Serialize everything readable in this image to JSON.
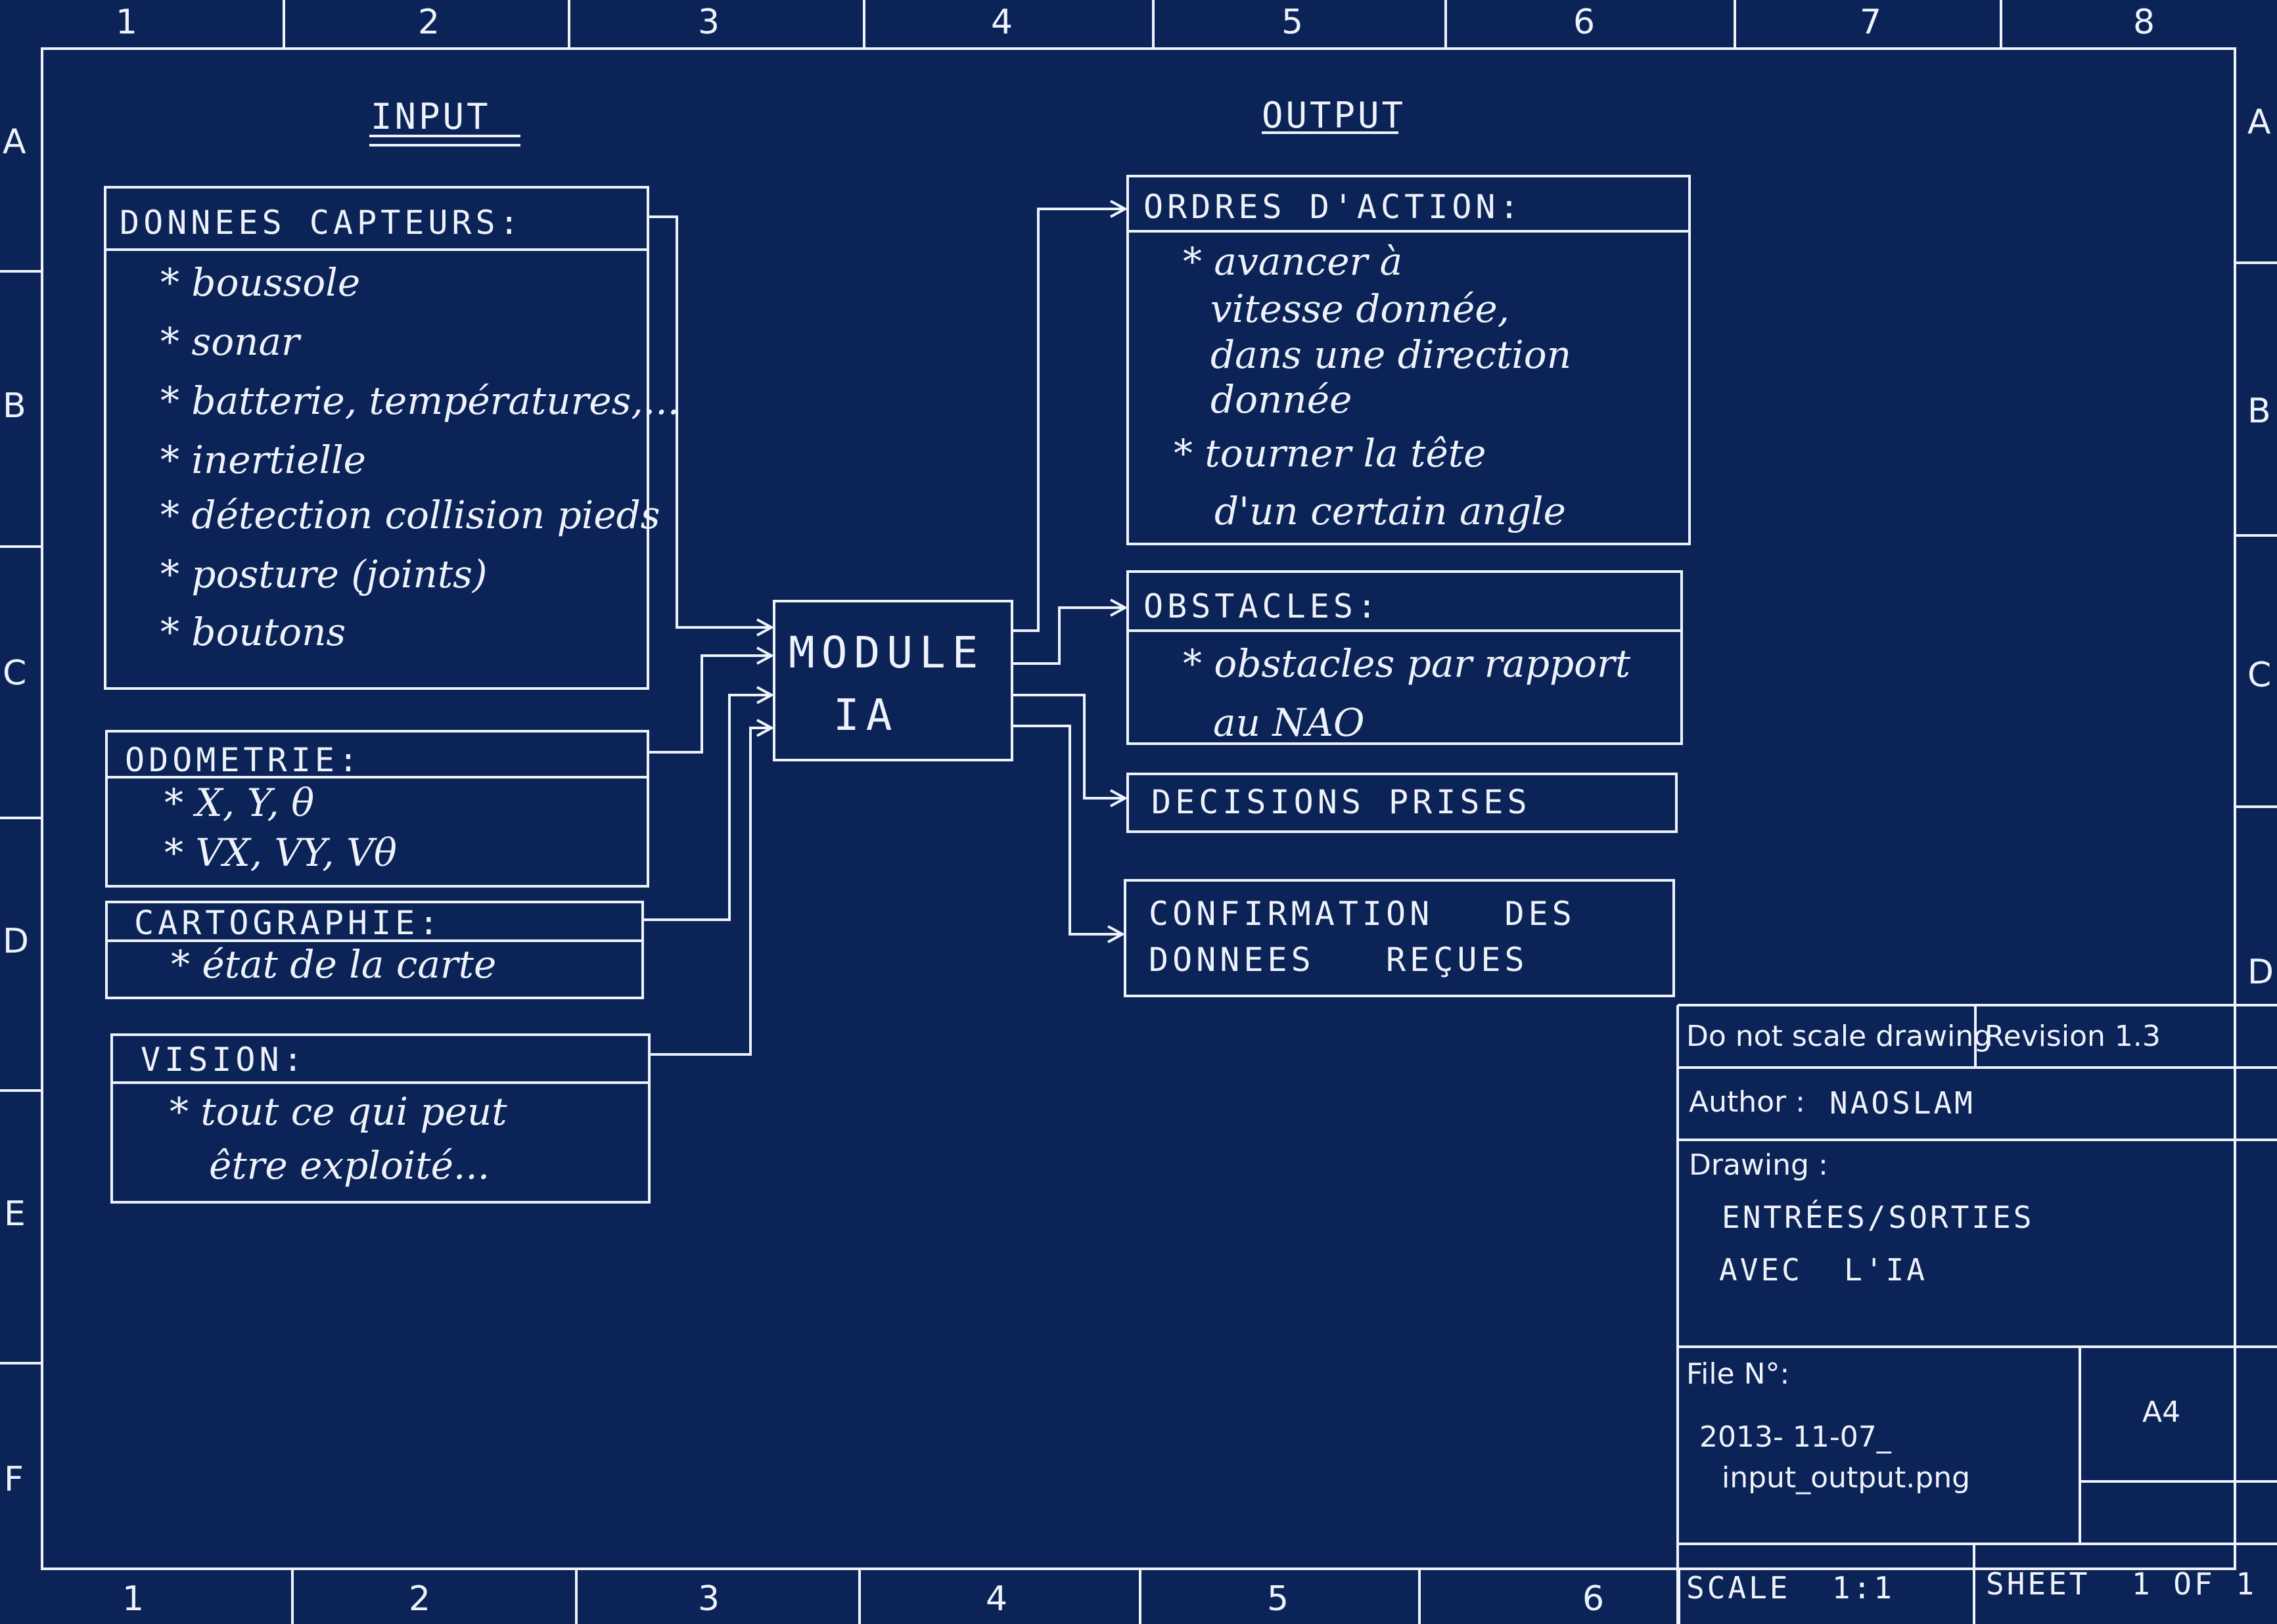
{
  "grid": {
    "top_cols": [
      "1",
      "2",
      "3",
      "4",
      "5",
      "6",
      "7",
      "8"
    ],
    "bottom_cols": [
      "1",
      "2",
      "3",
      "4",
      "5",
      "6"
    ],
    "rows_left": [
      "A",
      "B",
      "C",
      "D",
      "E",
      "F"
    ],
    "rows_right": [
      "A",
      "B",
      "C",
      "D"
    ]
  },
  "headings": {
    "input": "INPUT",
    "output": "OUTPUT"
  },
  "module": {
    "line1": "MODULE",
    "line2": "IA"
  },
  "inputs": {
    "capteurs": {
      "title": "DONNEES CAPTEURS:",
      "items": [
        "* boussole",
        "* sonar",
        "* batterie, températures,...",
        "* inertielle",
        "* détection collision pieds",
        "* posture (joints)",
        "* boutons"
      ]
    },
    "odometrie": {
      "title": "ODOMETRIE:",
      "items": [
        "* X, Y, θ",
        "* VX, VY, Vθ"
      ]
    },
    "cartographie": {
      "title": "CARTOGRAPHIE:",
      "items": [
        "* état de la carte"
      ]
    },
    "vision": {
      "title": "VISION:",
      "items": [
        "* tout ce qui peut",
        "être exploité..."
      ]
    }
  },
  "outputs": {
    "ordres": {
      "title": "ORDRES D'ACTION:",
      "items": [
        "* avancer à",
        "vitesse donnée,",
        "dans une direction",
        "donnée",
        "* tourner la tête",
        "d'un certain angle"
      ]
    },
    "obstacles": {
      "title": "OBSTACLES:",
      "items": [
        "* obstacles par rapport",
        "au NAO"
      ]
    },
    "decisions": {
      "title": "DECISIONS PRISES"
    },
    "confirmation": {
      "line1": "CONFIRMATION   DES",
      "line2": "DONNEES   REÇUES"
    }
  },
  "title_block": {
    "no_scale": "Do not scale drawing",
    "revision": "Revision 1.3",
    "author_label": "Author :",
    "author": "NAOSLAM",
    "drawing_label": "Drawing :",
    "drawing_line1": "ENTRÉES/SORTIES",
    "drawing_line2": "AVEC  L'IA",
    "file_label": "File N°:",
    "file_line1": "2013- 11-07_",
    "file_line2": "input_output.png",
    "size": "A4",
    "scale": "SCALE  1:1",
    "sheet": "SHEET  1 OF 1"
  }
}
